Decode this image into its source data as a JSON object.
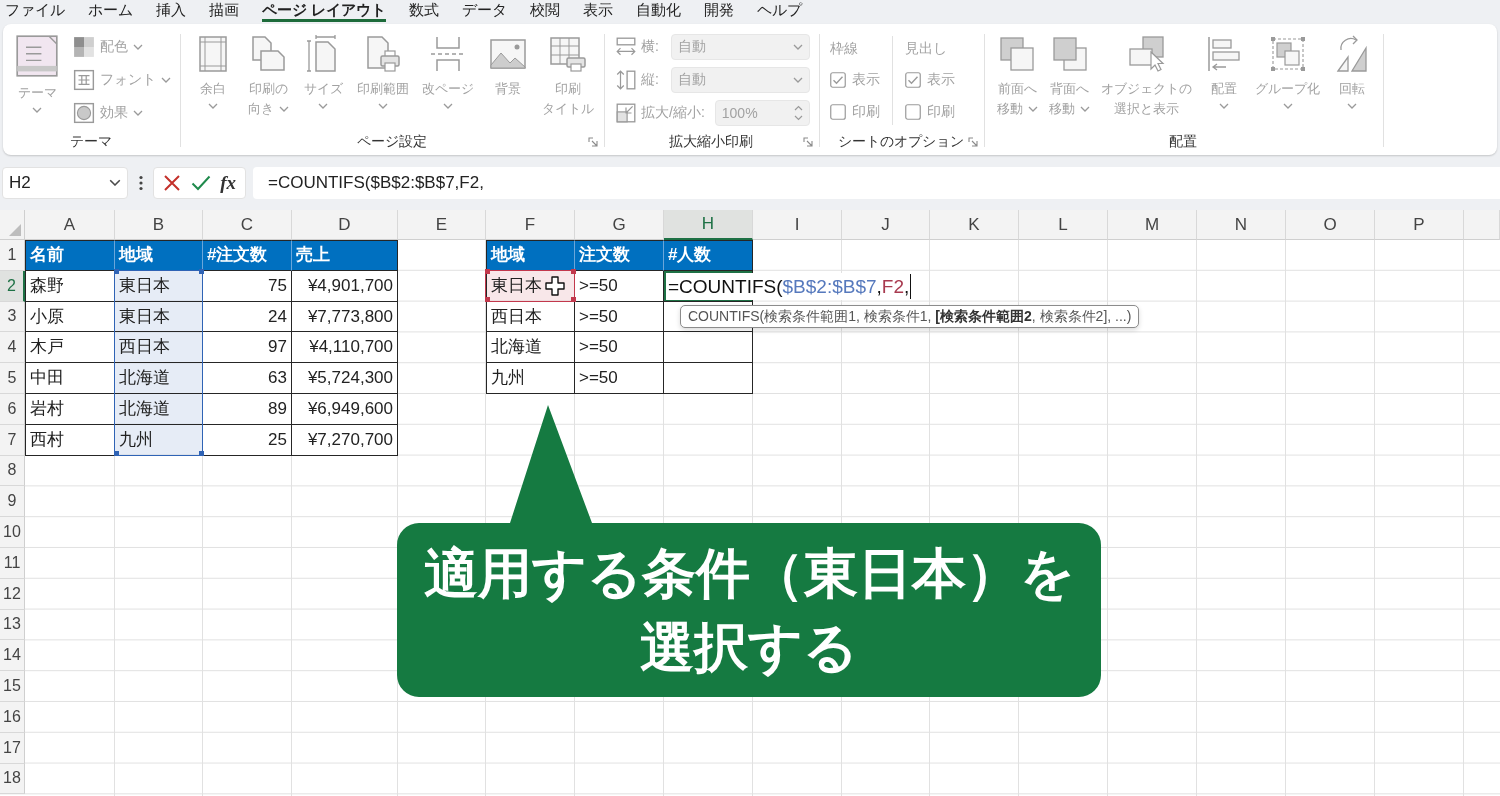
{
  "menu_tabs": [
    {
      "label": "ファイル",
      "selected": false
    },
    {
      "label": "ホーム",
      "selected": false
    },
    {
      "label": "挿入",
      "selected": false
    },
    {
      "label": "描画",
      "selected": false
    },
    {
      "label": "ページ レイアウト",
      "selected": true
    },
    {
      "label": "数式",
      "selected": false
    },
    {
      "label": "データ",
      "selected": false
    },
    {
      "label": "校閲",
      "selected": false
    },
    {
      "label": "表示",
      "selected": false
    },
    {
      "label": "自動化",
      "selected": false
    },
    {
      "label": "開発",
      "selected": false
    },
    {
      "label": "ヘルプ",
      "selected": false
    }
  ],
  "ribbon": {
    "groups": [
      {
        "title": "テーマ",
        "launcher": false,
        "items": [
          {
            "kind": "large",
            "lines": [
              "テーマ"
            ],
            "dropdown": true,
            "disabled": true
          },
          {
            "kind": "small",
            "lines": [
              "配色"
            ],
            "dropdown": true,
            "disabled": true
          },
          {
            "kind": "small",
            "lines": [
              "フォント"
            ],
            "dropdown": true,
            "disabled": true
          },
          {
            "kind": "small",
            "lines": [
              "効果"
            ],
            "dropdown": true,
            "disabled": true
          }
        ]
      },
      {
        "title": "ページ設定",
        "launcher": true,
        "items": [
          {
            "kind": "large",
            "lines": [
              "余白"
            ],
            "dropdown": true,
            "disabled": true
          },
          {
            "kind": "large",
            "lines": [
              "印刷の",
              "向き"
            ],
            "dropdown": true,
            "disabled": true
          },
          {
            "kind": "large",
            "lines": [
              "サイズ"
            ],
            "dropdown": true,
            "disabled": true
          },
          {
            "kind": "large",
            "lines": [
              "印刷範囲"
            ],
            "dropdown": true,
            "disabled": true
          },
          {
            "kind": "large",
            "lines": [
              "改ページ"
            ],
            "dropdown": true,
            "disabled": true
          },
          {
            "kind": "large",
            "lines": [
              "背景"
            ],
            "dropdown": false,
            "disabled": true
          },
          {
            "kind": "large",
            "lines": [
              "印刷",
              "タイトル"
            ],
            "dropdown": false,
            "disabled": true
          }
        ]
      },
      {
        "title": "拡大縮小印刷",
        "launcher": true,
        "items": [
          {
            "kind": "select",
            "label": "横:",
            "value": "自動",
            "disabled": true
          },
          {
            "kind": "select",
            "label": "縦:",
            "value": "自動",
            "disabled": true
          },
          {
            "kind": "spinner",
            "label": "拡大/縮小:",
            "value": "100%",
            "disabled": true
          }
        ]
      },
      {
        "title": "シートのオプション",
        "launcher": true,
        "items": [
          {
            "kind": "checks",
            "heading": "枠線",
            "disabled": true,
            "options": [
              {
                "label": "表示",
                "checked": true
              },
              {
                "label": "印刷",
                "checked": false
              }
            ]
          },
          {
            "kind": "checks",
            "heading": "見出し",
            "disabled": true,
            "options": [
              {
                "label": "表示",
                "checked": true
              },
              {
                "label": "印刷",
                "checked": false
              }
            ]
          }
        ]
      },
      {
        "title": "配置",
        "launcher": false,
        "items": [
          {
            "kind": "large",
            "lines": [
              "前面へ",
              "移動"
            ],
            "dropdown": true,
            "disabled": true
          },
          {
            "kind": "large",
            "lines": [
              "背面へ",
              "移動"
            ],
            "dropdown": true,
            "disabled": true
          },
          {
            "kind": "large",
            "lines": [
              "オブジェクトの",
              "選択と表示"
            ],
            "dropdown": false,
            "disabled": true
          },
          {
            "kind": "large",
            "lines": [
              "配置"
            ],
            "dropdown": true,
            "disabled": true
          },
          {
            "kind": "large",
            "lines": [
              "グループ化"
            ],
            "dropdown": true,
            "disabled": true
          },
          {
            "kind": "large",
            "lines": [
              "回転"
            ],
            "dropdown": true,
            "disabled": true
          }
        ]
      }
    ]
  },
  "formula_bar": {
    "name_box": "H2",
    "function_label": "fx",
    "formula": "=COUNTIFS($B$2:$B$7,F2,"
  },
  "sheet": {
    "columns": [
      {
        "label": "A",
        "selected": false
      },
      {
        "label": "B",
        "selected": false
      },
      {
        "label": "C",
        "selected": false
      },
      {
        "label": "D",
        "selected": false
      },
      {
        "label": "E",
        "selected": false
      },
      {
        "label": "F",
        "selected": false
      },
      {
        "label": "G",
        "selected": false
      },
      {
        "label": "H",
        "selected": true
      },
      {
        "label": "I",
        "selected": false
      },
      {
        "label": "J",
        "selected": false
      },
      {
        "label": "K",
        "selected": false
      },
      {
        "label": "L",
        "selected": false
      },
      {
        "label": "M",
        "selected": false
      },
      {
        "label": "N",
        "selected": false
      },
      {
        "label": "O",
        "selected": false
      },
      {
        "label": "P",
        "selected": false
      }
    ],
    "rows": [
      {
        "label": "1",
        "selected": false
      },
      {
        "label": "2",
        "selected": true
      },
      {
        "label": "3",
        "selected": false
      },
      {
        "label": "4",
        "selected": false
      },
      {
        "label": "5",
        "selected": false
      },
      {
        "label": "6",
        "selected": false
      },
      {
        "label": "7",
        "selected": false
      },
      {
        "label": "8",
        "selected": false
      },
      {
        "label": "9",
        "selected": false
      },
      {
        "label": "10",
        "selected": false
      },
      {
        "label": "11",
        "selected": false
      },
      {
        "label": "12",
        "selected": false
      },
      {
        "label": "13",
        "selected": false
      },
      {
        "label": "14",
        "selected": false
      },
      {
        "label": "15",
        "selected": false
      },
      {
        "label": "16",
        "selected": false
      },
      {
        "label": "17",
        "selected": false
      },
      {
        "label": "18",
        "selected": false
      }
    ]
  },
  "tables": [
    {
      "color": "#2f63b5",
      "columns": [
        {
          "label": "名前",
          "kind": "text"
        },
        {
          "label": "地域",
          "kind": "text"
        },
        {
          "label": "#注文数",
          "kind": "number"
        },
        {
          "label": "売上",
          "kind": "number"
        }
      ],
      "rows": [
        [
          {
            "text": "森野",
            "ref": false,
            "active": false
          },
          {
            "text": "東日本",
            "ref": true,
            "active": false
          },
          {
            "text": "75",
            "ref": false,
            "active": false
          },
          {
            "text": "¥4,901,700",
            "ref": false,
            "active": false
          }
        ],
        [
          {
            "text": "小原",
            "ref": false,
            "active": false
          },
          {
            "text": "東日本",
            "ref": true,
            "active": false
          },
          {
            "text": "24",
            "ref": false,
            "active": false
          },
          {
            "text": "¥7,773,800",
            "ref": false,
            "active": false
          }
        ],
        [
          {
            "text": "木戸",
            "ref": false,
            "active": false
          },
          {
            "text": "西日本",
            "ref": true,
            "active": false
          },
          {
            "text": "97",
            "ref": false,
            "active": false
          },
          {
            "text": "¥4,110,700",
            "ref": false,
            "active": false
          }
        ],
        [
          {
            "text": "中田",
            "ref": false,
            "active": false
          },
          {
            "text": "北海道",
            "ref": true,
            "active": false
          },
          {
            "text": "63",
            "ref": false,
            "active": false
          },
          {
            "text": "¥5,724,300",
            "ref": false,
            "active": false
          }
        ],
        [
          {
            "text": "岩村",
            "ref": false,
            "active": false
          },
          {
            "text": "北海道",
            "ref": true,
            "active": false
          },
          {
            "text": "89",
            "ref": false,
            "active": false
          },
          {
            "text": "¥6,949,600",
            "ref": false,
            "active": false
          }
        ],
        [
          {
            "text": "西村",
            "ref": false,
            "active": false
          },
          {
            "text": "九州",
            "ref": true,
            "active": false
          },
          {
            "text": "25",
            "ref": false,
            "active": false
          },
          {
            "text": "¥7,270,700",
            "ref": false,
            "active": false
          }
        ]
      ]
    },
    {
      "color": "#c2384c",
      "columns": [
        {
          "label": "地域",
          "kind": "text"
        },
        {
          "label": "注文数",
          "kind": "text"
        },
        {
          "label": "#人数",
          "kind": "number"
        }
      ],
      "rows": [
        [
          {
            "text": "東日本",
            "ref": true,
            "active": false
          },
          {
            "text": ">=50",
            "ref": false,
            "active": false
          },
          {
            "ref": false,
            "active": true
          }
        ],
        [
          {
            "text": "西日本",
            "ref": false,
            "active": false
          },
          {
            "text": ">=50",
            "ref": false,
            "active": false
          },
          {
            "ref": false,
            "active": false
          }
        ],
        [
          {
            "text": "北海道",
            "ref": false,
            "active": false
          },
          {
            "text": ">=50",
            "ref": false,
            "active": false
          },
          {
            "ref": false,
            "active": false
          }
        ],
        [
          {
            "text": "九州",
            "ref": false,
            "active": false
          },
          {
            "text": ">=50",
            "ref": false,
            "active": false
          },
          {
            "ref": false,
            "active": false
          }
        ]
      ]
    }
  ],
  "cell_editor": {
    "parts": [
      {
        "kind": "plain",
        "text": "=COUNTIFS("
      },
      {
        "kind": "ref",
        "text": "$B$2:$B$7",
        "color": "#5679bd"
      },
      {
        "kind": "plain",
        "text": ","
      },
      {
        "kind": "ref",
        "text": "F2",
        "color": "#a83a4f"
      },
      {
        "kind": "plain",
        "text": ","
      }
    ]
  },
  "tooltip": "COUNTIFS(検索条件範囲1, 検索条件1, **[検索条件範囲2**, 検索条件2], ...)",
  "callout": {
    "lines": [
      "適用する条件（東日本）を",
      "選択する"
    ]
  }
}
